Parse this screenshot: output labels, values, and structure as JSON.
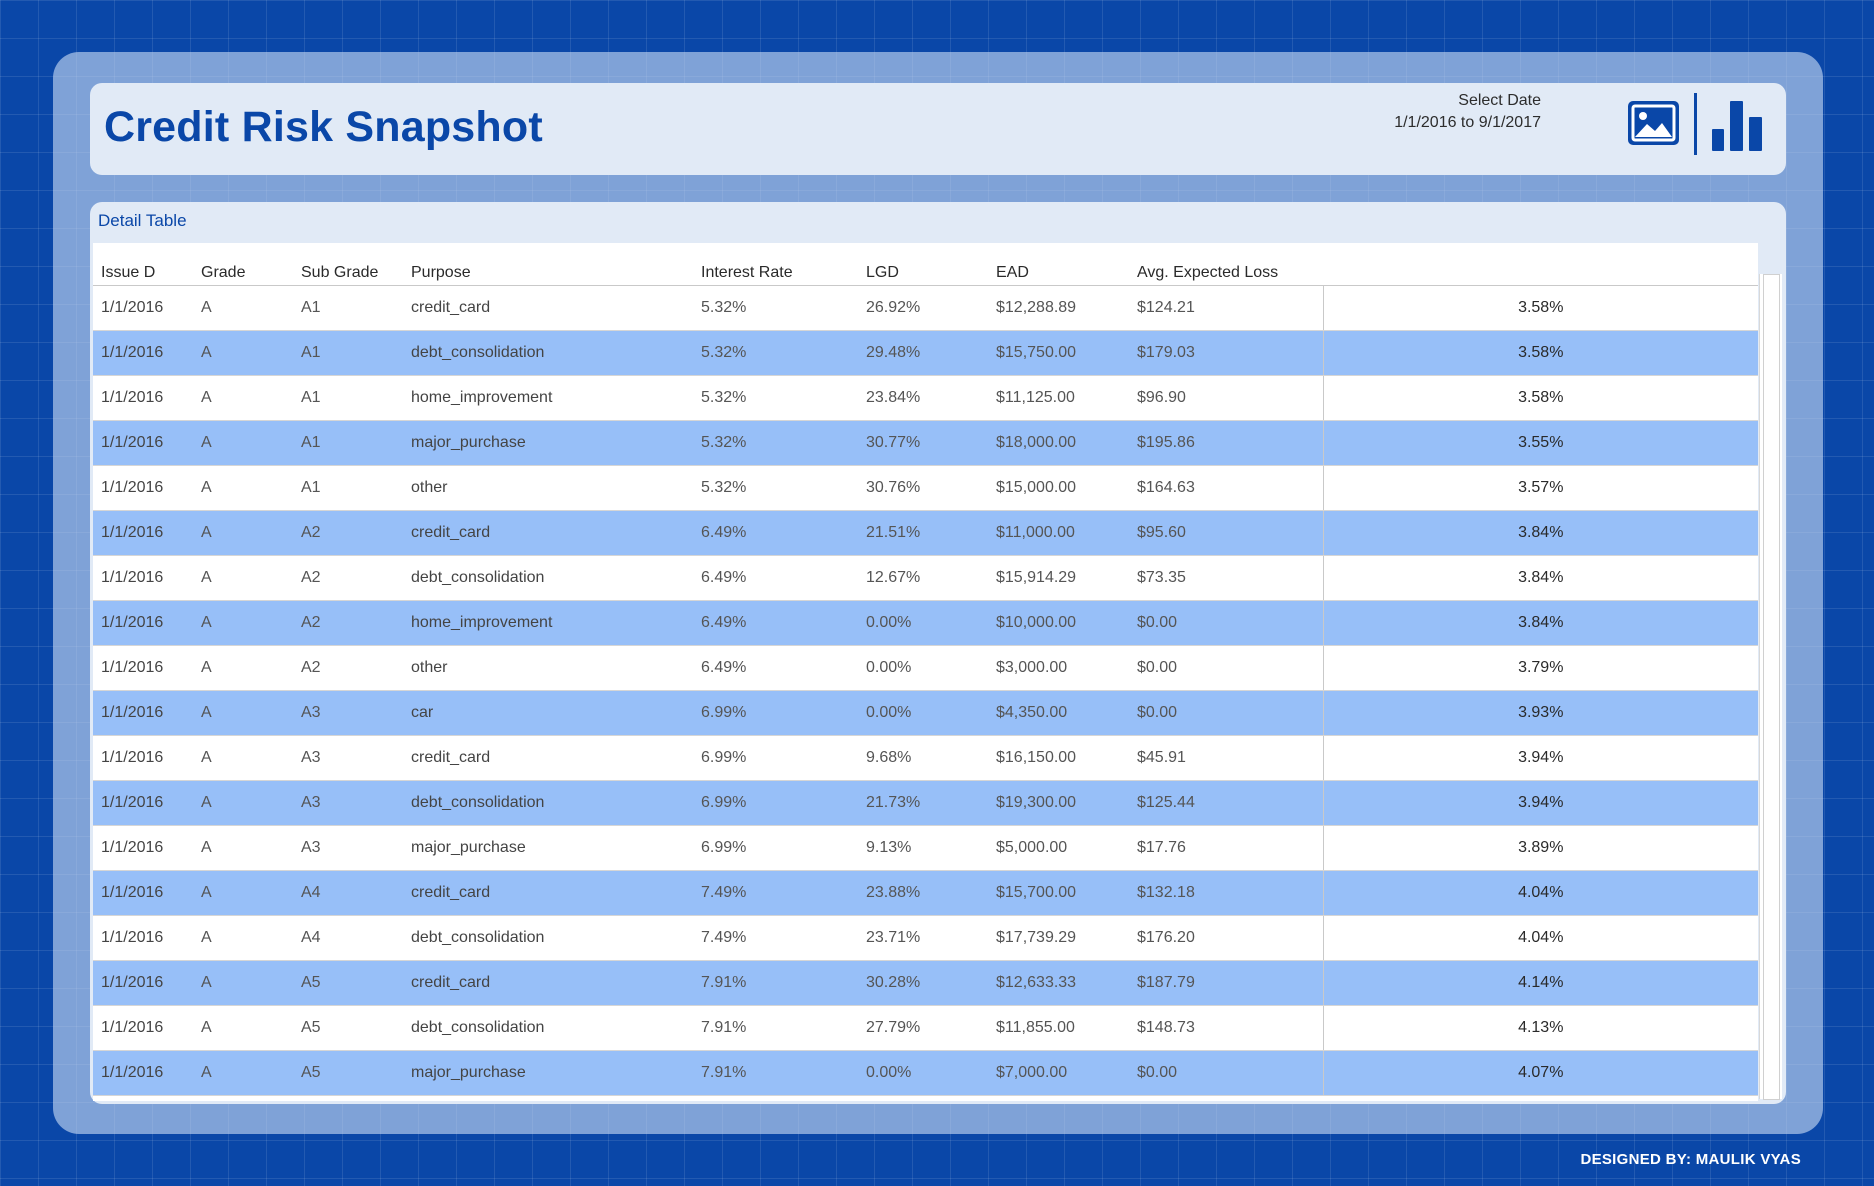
{
  "header": {
    "title": "Credit Risk Snapshot",
    "date_label": "Select Date",
    "date_range": "1/1/2016 to 9/1/2017",
    "image_icon": "image-icon",
    "chart_icon": "bar-chart-icon"
  },
  "table": {
    "title": "Detail Table",
    "columns": [
      "Issue D",
      "Grade",
      "Sub Grade",
      "Purpose",
      "Interest Rate",
      "LGD",
      "EAD",
      "Avg. Expected Loss",
      ""
    ],
    "rows": [
      [
        "1/1/2016",
        "A",
        "A1",
        "credit_card",
        "5.32%",
        "26.92%",
        "$12,288.89",
        "$124.21",
        "3.58%"
      ],
      [
        "1/1/2016",
        "A",
        "A1",
        "debt_consolidation",
        "5.32%",
        "29.48%",
        "$15,750.00",
        "$179.03",
        "3.58%"
      ],
      [
        "1/1/2016",
        "A",
        "A1",
        "home_improvement",
        "5.32%",
        "23.84%",
        "$11,125.00",
        "$96.90",
        "3.58%"
      ],
      [
        "1/1/2016",
        "A",
        "A1",
        "major_purchase",
        "5.32%",
        "30.77%",
        "$18,000.00",
        "$195.86",
        "3.55%"
      ],
      [
        "1/1/2016",
        "A",
        "A1",
        "other",
        "5.32%",
        "30.76%",
        "$15,000.00",
        "$164.63",
        "3.57%"
      ],
      [
        "1/1/2016",
        "A",
        "A2",
        "credit_card",
        "6.49%",
        "21.51%",
        "$11,000.00",
        "$95.60",
        "3.84%"
      ],
      [
        "1/1/2016",
        "A",
        "A2",
        "debt_consolidation",
        "6.49%",
        "12.67%",
        "$15,914.29",
        "$73.35",
        "3.84%"
      ],
      [
        "1/1/2016",
        "A",
        "A2",
        "home_improvement",
        "6.49%",
        "0.00%",
        "$10,000.00",
        "$0.00",
        "3.84%"
      ],
      [
        "1/1/2016",
        "A",
        "A2",
        "other",
        "6.49%",
        "0.00%",
        "$3,000.00",
        "$0.00",
        "3.79%"
      ],
      [
        "1/1/2016",
        "A",
        "A3",
        "car",
        "6.99%",
        "0.00%",
        "$4,350.00",
        "$0.00",
        "3.93%"
      ],
      [
        "1/1/2016",
        "A",
        "A3",
        "credit_card",
        "6.99%",
        "9.68%",
        "$16,150.00",
        "$45.91",
        "3.94%"
      ],
      [
        "1/1/2016",
        "A",
        "A3",
        "debt_consolidation",
        "6.99%",
        "21.73%",
        "$19,300.00",
        "$125.44",
        "3.94%"
      ],
      [
        "1/1/2016",
        "A",
        "A3",
        "major_purchase",
        "6.99%",
        "9.13%",
        "$5,000.00",
        "$17.76",
        "3.89%"
      ],
      [
        "1/1/2016",
        "A",
        "A4",
        "credit_card",
        "7.49%",
        "23.88%",
        "$15,700.00",
        "$132.18",
        "4.04%"
      ],
      [
        "1/1/2016",
        "A",
        "A4",
        "debt_consolidation",
        "7.49%",
        "23.71%",
        "$17,739.29",
        "$176.20",
        "4.04%"
      ],
      [
        "1/1/2016",
        "A",
        "A5",
        "credit_card",
        "7.91%",
        "30.28%",
        "$12,633.33",
        "$187.79",
        "4.14%"
      ],
      [
        "1/1/2016",
        "A",
        "A5",
        "debt_consolidation",
        "7.91%",
        "27.79%",
        "$11,855.00",
        "$148.73",
        "4.13%"
      ],
      [
        "1/1/2016",
        "A",
        "A5",
        "major_purchase",
        "7.91%",
        "0.00%",
        "$7,000.00",
        "$0.00",
        "4.07%"
      ]
    ]
  },
  "footer": {
    "credit": "DESIGNED BY: MAULIK VYAS"
  },
  "colors": {
    "background": "#0a47a8",
    "accent": "#0a47a8",
    "row_highlight": "#97bff8"
  }
}
